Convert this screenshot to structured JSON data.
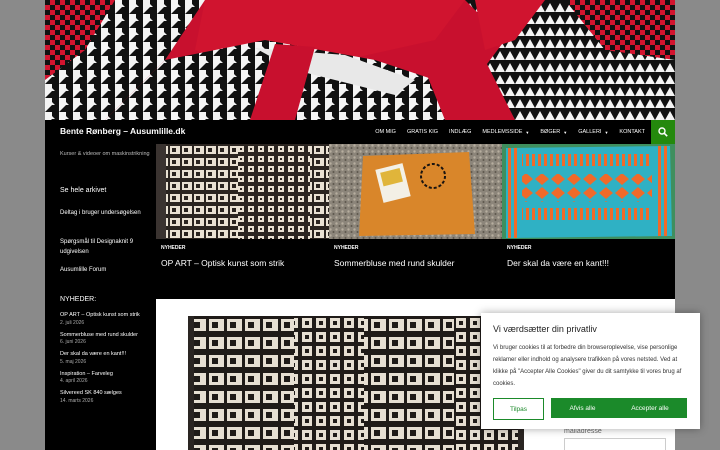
{
  "header": {
    "site_title": "Bente Rønberg – Ausumlille.dk",
    "menu": [
      {
        "label": "OM MIG",
        "has_dropdown": false
      },
      {
        "label": "GRATIS KIG",
        "has_dropdown": false
      },
      {
        "label": "INDLÆG",
        "has_dropdown": false
      },
      {
        "label": "MEDLEMSSIDE",
        "has_dropdown": true
      },
      {
        "label": "BØGER",
        "has_dropdown": true
      },
      {
        "label": "GALLERI",
        "has_dropdown": true
      },
      {
        "label": "KONTAKT",
        "has_dropdown": false
      }
    ],
    "search_icon": "search-icon"
  },
  "sidebar": {
    "description": "Kurser & videoer om maskinstrikning",
    "archive_link": "Se hele arkivet",
    "join_link": "Deltag i bruger undersø­gelsen",
    "design_link": "Spørgsmål til Designaknit 9 udgivelsen",
    "forum_link": "Ausumlille Forum",
    "news_heading": "NYHEDER:",
    "news": [
      {
        "title": "OP ART – Optisk kunst som strik",
        "date": "2. juli 2026"
      },
      {
        "title": "Sommerbluse med rund skulder",
        "date": "6. juni 2026"
      },
      {
        "title": "Der skal da være en kant!!!",
        "date": "5. maj 2026"
      },
      {
        "title": "Inspiration – Farveleg",
        "date": "4. april 2026"
      },
      {
        "title": "Silvereed SK 840 sælges",
        "date": "14. marts 2026"
      }
    ]
  },
  "featured": [
    {
      "category": "NYHEDER",
      "title": "OP ART – Optisk kunst som strik"
    },
    {
      "category": "NYHEDER",
      "title": "Sommerbluse med rund skulder"
    },
    {
      "category": "NYHEDER",
      "title": "Der skal da være en kant!!!"
    }
  ],
  "main": {
    "email_label": "mailadresse"
  },
  "cookie": {
    "title": "Vi værdsætter din privatliv",
    "text": "Vi bruger cookies til at forbedre din browseroplevelse, vise personlige reklamer eller indhold og analysere trafikken på vores netsted. Ved at klikke på \"Accepter Alle Cookies\" giver du dit samtykke til vores brug af cookies.",
    "btn_adjust": "Tilpas",
    "btn_reject": "Afvis alle",
    "btn_accept": "Accepter alle"
  },
  "colors": {
    "accent_green": "#24890d",
    "cookie_green": "#1b8a2a",
    "knit_red": "#c8102e"
  }
}
